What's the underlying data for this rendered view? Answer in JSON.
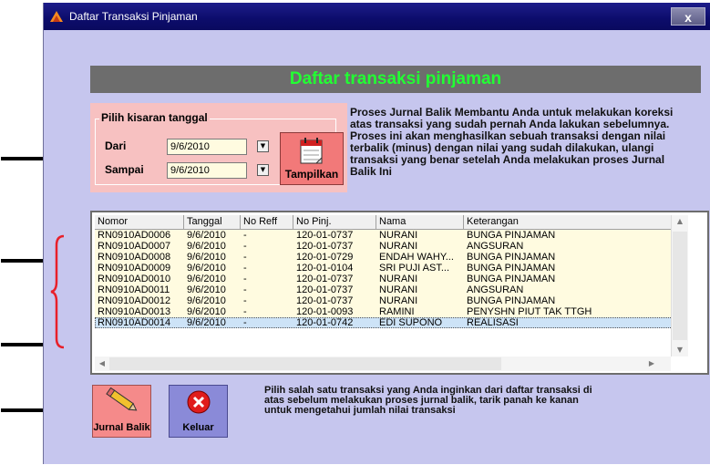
{
  "window": {
    "title": "Daftar Transaksi Pinjaman",
    "close_label": "x"
  },
  "header": {
    "title": "Daftar transaksi pinjaman"
  },
  "date_range": {
    "group_label": "Pilih kisaran tanggal",
    "from_label": "Dari",
    "from_value": "9/6/2010",
    "to_label": "Sampai",
    "to_value": "9/6/2010",
    "show_button": "Tampilkan"
  },
  "description": "Proses Jurnal Balik Membantu Anda untuk melakukan koreksi atas transaksi yang sudah pernah Anda lakukan sebelumnya. Proses ini akan menghasilkan sebuah transaksi dengan nilai terbalik (minus) dengan nilai yang sudah dilakukan, ulangi transaksi yang benar setelah Anda melakukan proses Jurnal Balik Ini",
  "table": {
    "columns": [
      "Nomor",
      "Tanggal",
      "No Reff",
      "No Pinj.",
      "Nama",
      "Keterangan"
    ],
    "rows": [
      {
        "nomor": "RN0910AD0006",
        "tanggal": "9/6/2010",
        "reff": "-",
        "pinj": "120-01-0737",
        "nama": "NURANI",
        "ket": "BUNGA PINJAMAN"
      },
      {
        "nomor": "RN0910AD0007",
        "tanggal": "9/6/2010",
        "reff": "-",
        "pinj": "120-01-0737",
        "nama": "NURANI",
        "ket": "ANGSURAN"
      },
      {
        "nomor": "RN0910AD0008",
        "tanggal": "9/6/2010",
        "reff": "-",
        "pinj": "120-01-0729",
        "nama": "ENDAH WAHY...",
        "ket": "BUNGA PINJAMAN"
      },
      {
        "nomor": "RN0910AD0009",
        "tanggal": "9/6/2010",
        "reff": "-",
        "pinj": "120-01-0104",
        "nama": "SRI PUJI AST...",
        "ket": "BUNGA PINJAMAN"
      },
      {
        "nomor": "RN0910AD0010",
        "tanggal": "9/6/2010",
        "reff": "-",
        "pinj": "120-01-0737",
        "nama": "NURANI",
        "ket": "BUNGA PINJAMAN"
      },
      {
        "nomor": "RN0910AD0011",
        "tanggal": "9/6/2010",
        "reff": "-",
        "pinj": "120-01-0737",
        "nama": "NURANI",
        "ket": "ANGSURAN"
      },
      {
        "nomor": "RN0910AD0012",
        "tanggal": "9/6/2010",
        "reff": "-",
        "pinj": "120-01-0737",
        "nama": "NURANI",
        "ket": "BUNGA PINJAMAN"
      },
      {
        "nomor": "RN0910AD0013",
        "tanggal": "9/6/2010",
        "reff": "-",
        "pinj": "120-01-0093",
        "nama": "RAMINI",
        "ket": "PENYSHN PIUT TAK TTGH"
      },
      {
        "nomor": "RN0910AD0014",
        "tanggal": "9/6/2010",
        "reff": "-",
        "pinj": "120-01-0742",
        "nama": "EDI SUPONO",
        "ket": "REALISASI"
      }
    ],
    "selected_row": 8
  },
  "buttons": {
    "jurnal_balik": "Jurnal Balik",
    "keluar": "Keluar"
  },
  "note": "Pilih salah satu transaksi yang Anda inginkan dari daftar transaksi di atas sebelum melakukan proses jurnal balik, tarik panah ke kanan untuk mengetahui jumlah nilai transaksi",
  "colors": {
    "title_bar": "#0c0c6b",
    "window_bg": "#c6c6ee",
    "header_text": "#22ff33",
    "panel_pink": "#f7c1c1",
    "row_bg": "#fffbe0",
    "annotation": "#e8202a"
  },
  "icons": {
    "title": "app-icon",
    "tampilkan": "calendar-icon",
    "jurnal_balik": "pencil-icon",
    "keluar": "close-circle-icon"
  }
}
